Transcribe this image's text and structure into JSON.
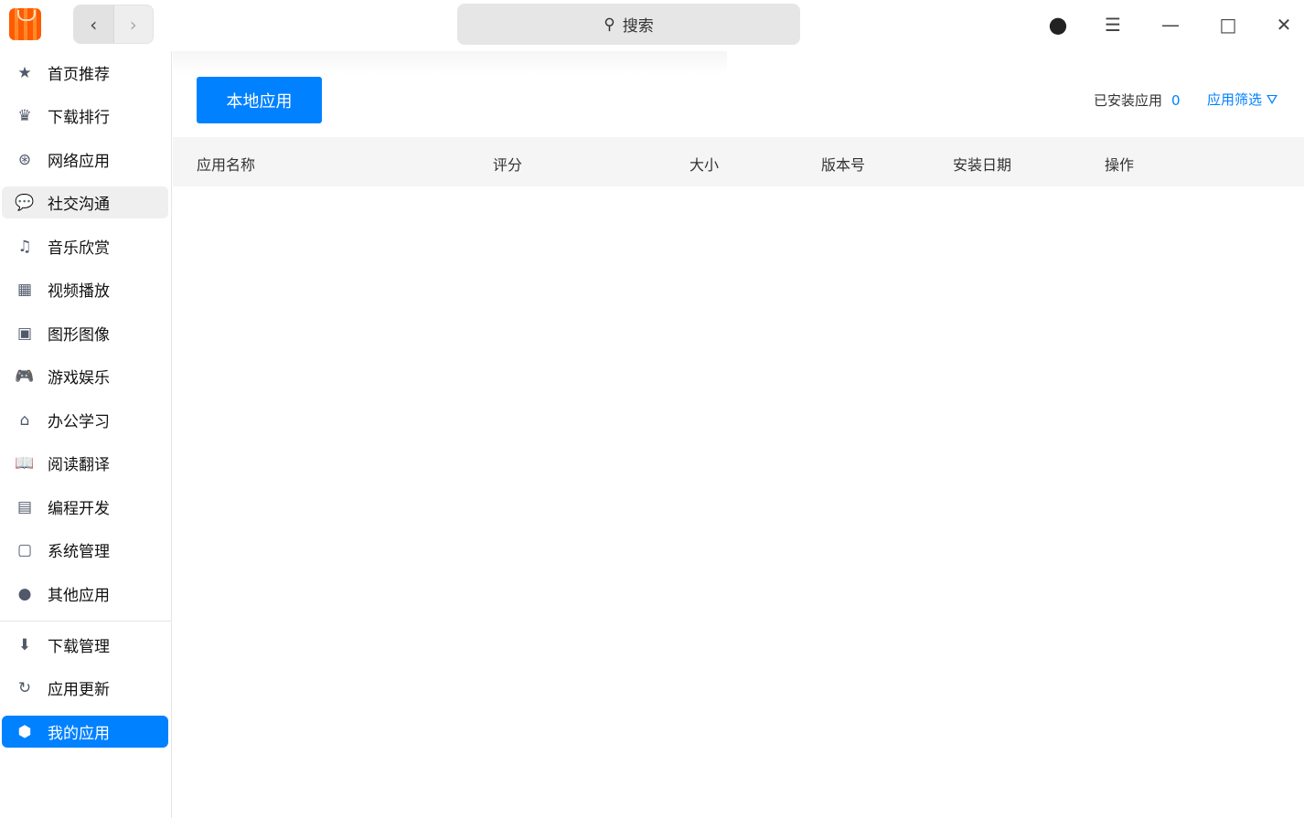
{
  "titlebar": {
    "search_placeholder": "搜索"
  },
  "sidebar": {
    "items": [
      {
        "label": "首页推荐",
        "icon": "★"
      },
      {
        "label": "下载排行",
        "icon": "♛"
      },
      {
        "label": "网络应用",
        "icon": "⊛"
      },
      {
        "label": "社交沟通",
        "icon": "💬"
      },
      {
        "label": "音乐欣赏",
        "icon": "♫"
      },
      {
        "label": "视频播放",
        "icon": "▦"
      },
      {
        "label": "图形图像",
        "icon": "▣"
      },
      {
        "label": "游戏娱乐",
        "icon": "🎮"
      },
      {
        "label": "办公学习",
        "icon": "⌂"
      },
      {
        "label": "阅读翻译",
        "icon": "📖"
      },
      {
        "label": "编程开发",
        "icon": "▤"
      },
      {
        "label": "系统管理",
        "icon": "▢"
      },
      {
        "label": "其他应用",
        "icon": "●"
      }
    ],
    "bottom_items": [
      {
        "label": "下载管理",
        "icon": "⬇"
      },
      {
        "label": "应用更新",
        "icon": "↻"
      },
      {
        "label": "我的应用",
        "icon": "⬢"
      }
    ]
  },
  "main": {
    "local_apps_button": "本地应用",
    "installed_label": "已安装应用",
    "installed_count": "0",
    "filter_label": "应用筛选",
    "columns": [
      "应用名称",
      "评分",
      "大小",
      "版本号",
      "安装日期",
      "操作"
    ]
  }
}
